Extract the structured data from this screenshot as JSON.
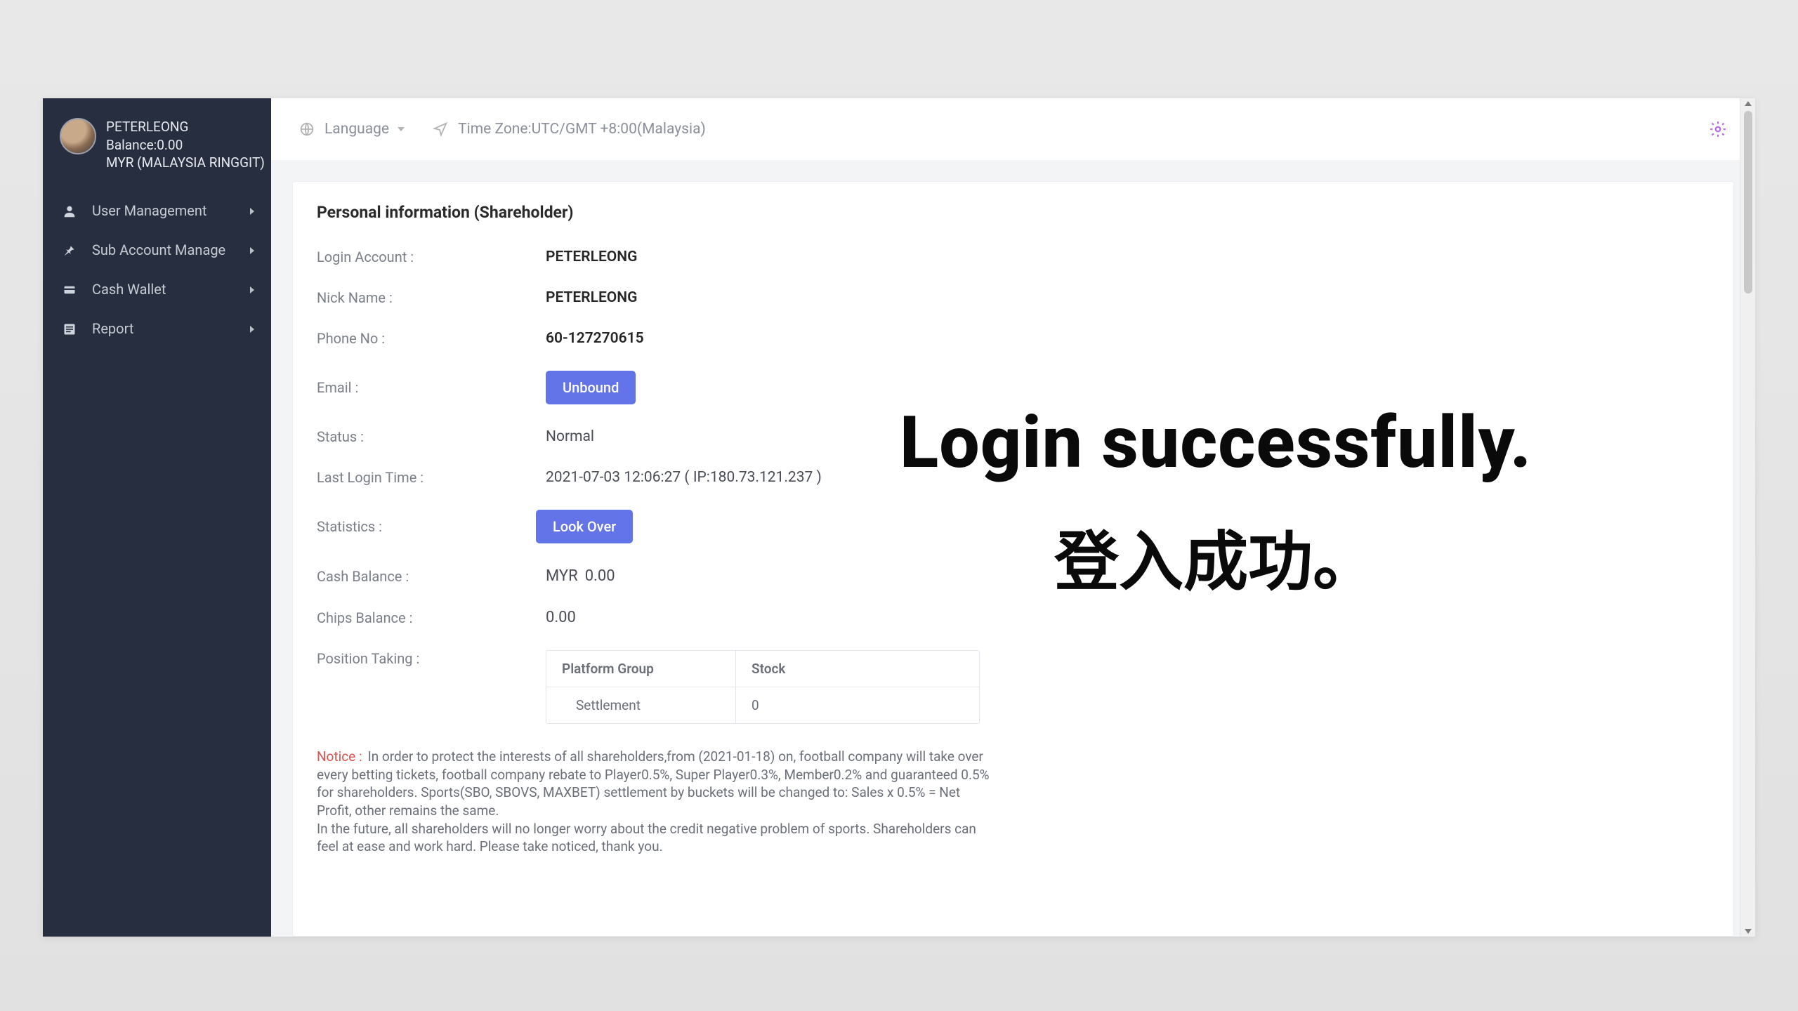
{
  "colors": {
    "accent": "#6274e7",
    "sidebar_bg": "#262e3f",
    "danger": "#d9534f",
    "gear": "#b36fe0"
  },
  "profile": {
    "name": "PETERLEONG",
    "balance_line": "Balance:0.00",
    "currency_line": "MYR (MALAYSIA RINGGIT)"
  },
  "sidebar": {
    "items": [
      {
        "icon": "user-icon",
        "label": "User Management"
      },
      {
        "icon": "pin-icon",
        "label": "Sub Account Manage"
      },
      {
        "icon": "wallet-icon",
        "label": "Cash Wallet"
      },
      {
        "icon": "report-icon",
        "label": "Report"
      }
    ]
  },
  "topbar": {
    "language_label": "Language",
    "timezone_label": "Time Zone:UTC/GMT +8:00(Malaysia)"
  },
  "page": {
    "title": "Personal information (Shareholder)",
    "fields": {
      "login_account": {
        "label": "Login Account :",
        "value": "PETERLEONG"
      },
      "nick_name": {
        "label": "Nick Name :",
        "value": "PETERLEONG"
      },
      "phone_no": {
        "label": "Phone No :",
        "value": "60-127270615"
      },
      "email": {
        "label": "Email :",
        "button": "Unbound"
      },
      "status": {
        "label": "Status :",
        "value": "Normal"
      },
      "last_login": {
        "label": "Last Login Time :",
        "value": "2021-07-03 12:06:27 ( IP:180.73.121.237 )"
      },
      "statistics": {
        "label": "Statistics :",
        "button": "Look Over"
      },
      "cash_balance": {
        "label": "Cash Balance :",
        "currency": "MYR",
        "value": "0.00"
      },
      "chips_balance": {
        "label": "Chips Balance :",
        "value": "0.00"
      },
      "position_taking": {
        "label": "Position Taking :",
        "table": {
          "headers": [
            "Platform Group",
            "Stock"
          ],
          "rows": [
            [
              "Settlement",
              "0"
            ]
          ]
        }
      }
    },
    "notice": {
      "label": "Notice :",
      "text": "In order to protect the interests of all shareholders,from (2021-01-18) on, football company will take over every betting tickets, football company rebate to Player0.5%, Super Player0.3%, Member0.2% and guaranteed 0.5% for shareholders. Sports(SBO, SBOVS, MAXBET) settlement by buckets will be changed to: Sales x 0.5% = Net Profit, other remains the same.\nIn the future, all shareholders will no longer worry about the credit negative problem of sports. Shareholders can feel at ease and work hard. Please take noticed, thank you."
    }
  },
  "overlay": {
    "en": "Login successfully.",
    "zh": "登入成功。"
  }
}
